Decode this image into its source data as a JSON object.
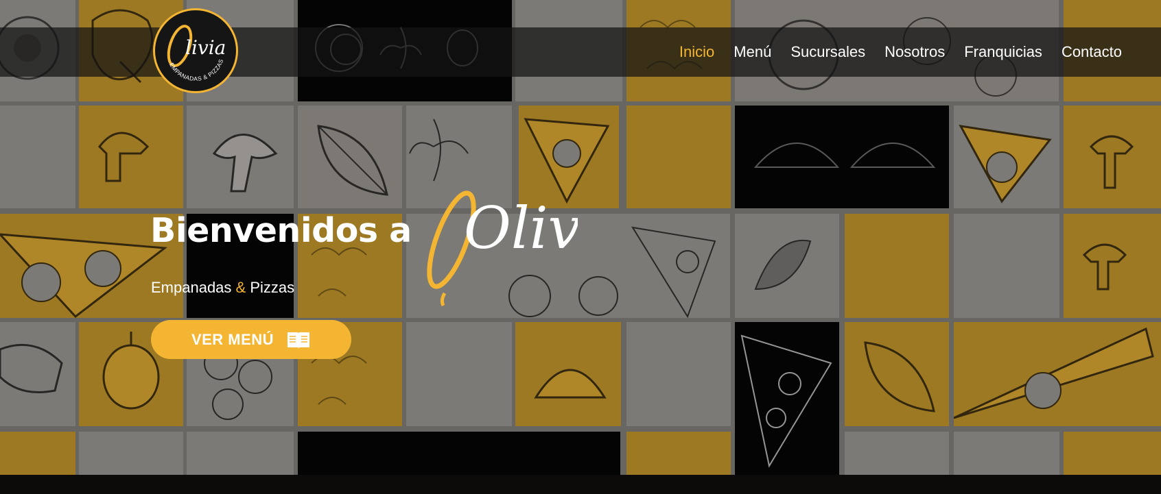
{
  "brand": {
    "logo_text": "Olivia",
    "logo_subtext": "EMPANADAS & PIZZAS",
    "accent_color": "#f4b533"
  },
  "nav": {
    "items": [
      {
        "label": "Inicio",
        "active": true
      },
      {
        "label": "Menú",
        "active": false
      },
      {
        "label": "Sucursales",
        "active": false
      },
      {
        "label": "Nosotros",
        "active": false
      },
      {
        "label": "Franquicias",
        "active": false
      },
      {
        "label": "Contacto",
        "active": false
      }
    ]
  },
  "hero": {
    "title": "Bienvenidos a",
    "title_logo": "Olivia",
    "tagline_part1": "Empanadas",
    "tagline_amp": "&",
    "tagline_part2": "Pizzas",
    "cta_label": "VER MENÚ",
    "cta_icon": "menu-book-icon"
  }
}
